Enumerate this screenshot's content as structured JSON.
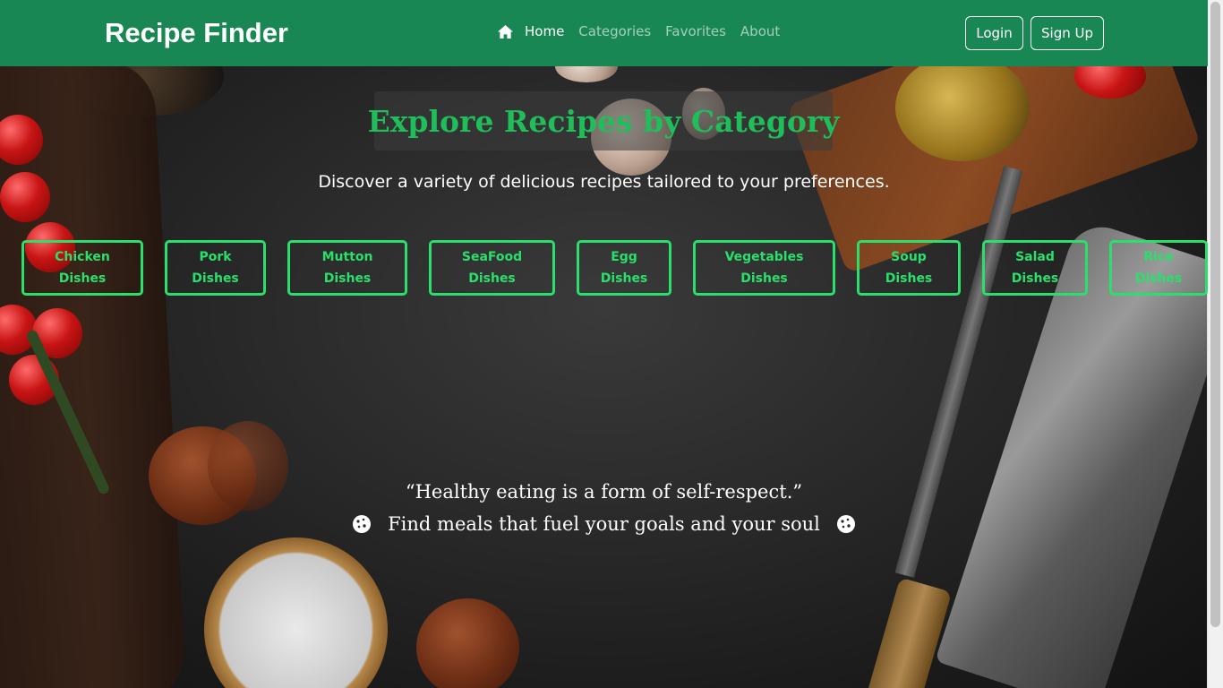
{
  "navbar": {
    "brand": "Recipe Finder",
    "links": [
      "Home",
      "Categories",
      "Favorites",
      "About"
    ],
    "login_label": "Login",
    "signup_label": "Sign Up",
    "background_color": "#198754"
  },
  "hero": {
    "title": "Explore Recipes by Category",
    "subtitle": "Discover a variety of delicious recipes tailored to your preferences.",
    "title_color": "#1fbe5a"
  },
  "categories": [
    {
      "line1": "Chicken",
      "line2": "Dishes"
    },
    {
      "line1": "Pork",
      "line2": "Dishes"
    },
    {
      "line1": "Mutton",
      "line2": "Dishes"
    },
    {
      "line1": "SeaFood",
      "line2": "Dishes"
    },
    {
      "line1": "Egg",
      "line2": "Dishes"
    },
    {
      "line1": "Vegetables",
      "line2": "Dishes"
    },
    {
      "line1": "Soup",
      "line2": "Dishes"
    },
    {
      "line1": "Salad",
      "line2": "Dishes"
    },
    {
      "line1": "Rice",
      "line2": "Dishes"
    }
  ],
  "quote": {
    "line1": "“Healthy eating is a form of self-respect.”",
    "line2": "Find meals that fuel your goals and your soul",
    "icon": "cookie-icon"
  },
  "accent_color": "#28e06b"
}
